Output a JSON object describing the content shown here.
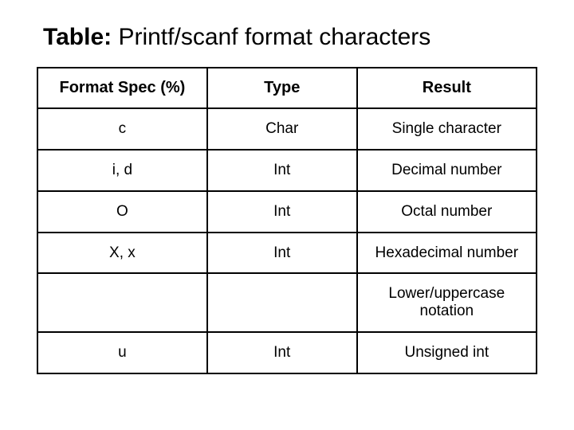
{
  "title_lead": "Table:",
  "title_rest": " Printf/scanf format characters",
  "headers": {
    "c1": "Format Spec (%)",
    "c2": "Type",
    "c3": "Result"
  },
  "rows": {
    "r1": {
      "spec": "c",
      "type": "Char",
      "result": "Single character"
    },
    "r2": {
      "spec": "i, d",
      "type": "Int",
      "result": "Decimal number"
    },
    "r3": {
      "spec": "O",
      "type": "Int",
      "result": "Octal number"
    },
    "r4": {
      "spec": "X, x",
      "type": "Int",
      "result": "Hexadecimal number"
    },
    "note": {
      "spec": "",
      "type": "",
      "result": "Lower/uppercase notation"
    },
    "r5": {
      "spec": "u",
      "type": "Int",
      "result": "Unsigned int"
    }
  }
}
